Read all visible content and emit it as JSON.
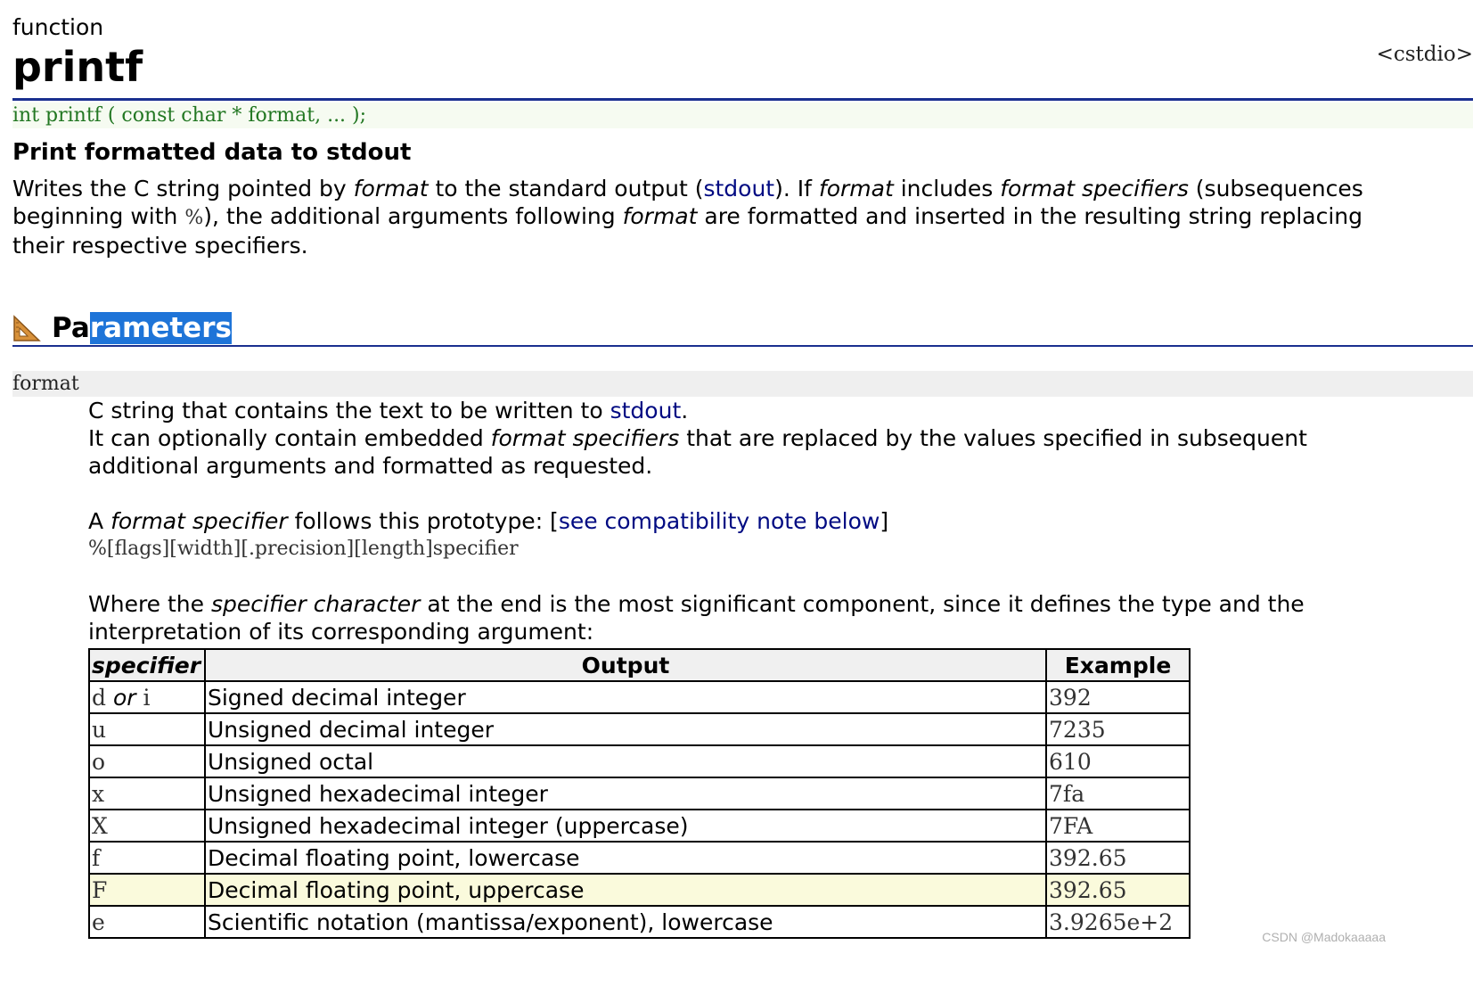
{
  "header": {
    "kind": "function",
    "name": "printf",
    "library": "<cstdio>"
  },
  "prototype": "int printf ( const char * format, ... );",
  "summary": "Print formatted data to stdout",
  "description": {
    "t1": "Writes the C string pointed by ",
    "t2": "format",
    "t3": " to the standard output (",
    "link_stdout": "stdout",
    "t4": "). If ",
    "t5": "format",
    "t6": " includes ",
    "t7": "format specifiers",
    "t8": " (subsequences beginning with ",
    "t9": "%",
    "t10": "), the additional arguments following ",
    "t11": "format",
    "t12": " are formatted and inserted in the resulting string replacing their respective specifiers."
  },
  "parameters_section": {
    "icon": "set-square-icon",
    "title_plain": "Pa",
    "title_selected": "rameters"
  },
  "param": {
    "name": "format",
    "line1_a": "C string that contains the text to be written to ",
    "line1_link": "stdout",
    "line1_b": ".",
    "line2_a": "It can optionally contain embedded ",
    "line2_b": "format specifiers",
    "line2_c": " that are replaced by the values specified in subsequent additional arguments and formatted as requested.",
    "line3_a": "A ",
    "line3_b": "format specifier",
    "line3_c": " follows this prototype: [",
    "line3_link": "see compatibility note below",
    "line3_d": "]",
    "proto_line": "%[flags][width][.precision][length]specifier",
    "line4_a": "Where the ",
    "line4_b": "specifier character",
    "line4_c": " at the end is the most significant component, since it defines the type and the interpretation of its corresponding argument:"
  },
  "table": {
    "headers": [
      "specifier",
      "Output",
      "Example"
    ],
    "rows": [
      {
        "spec_a": "d",
        "spec_or": " or ",
        "spec_b": "i",
        "output": "Signed decimal integer",
        "example": "392"
      },
      {
        "spec_a": "u",
        "output": "Unsigned decimal integer",
        "example": "7235"
      },
      {
        "spec_a": "o",
        "output": "Unsigned octal",
        "example": "610"
      },
      {
        "spec_a": "x",
        "output": "Unsigned hexadecimal integer",
        "example": "7fa"
      },
      {
        "spec_a": "X",
        "output": "Unsigned hexadecimal integer (uppercase)",
        "example": "7FA"
      },
      {
        "spec_a": "f",
        "output": "Decimal floating point, lowercase",
        "example": "392.65"
      },
      {
        "spec_a": "F",
        "output": "Decimal floating point, uppercase",
        "example": "392.65"
      },
      {
        "spec_a": "e",
        "output": "Scientific notation (mantissa/exponent), lowercase",
        "example": "3.9265e+2"
      }
    ]
  },
  "watermark": "CSDN @Madokaaaaa",
  "colors": {
    "link": "#000a82",
    "rule": "#1a2f8f",
    "prototype_text": "#227722",
    "selection": "#1e74d8",
    "highlight_row": "#fafadc"
  }
}
